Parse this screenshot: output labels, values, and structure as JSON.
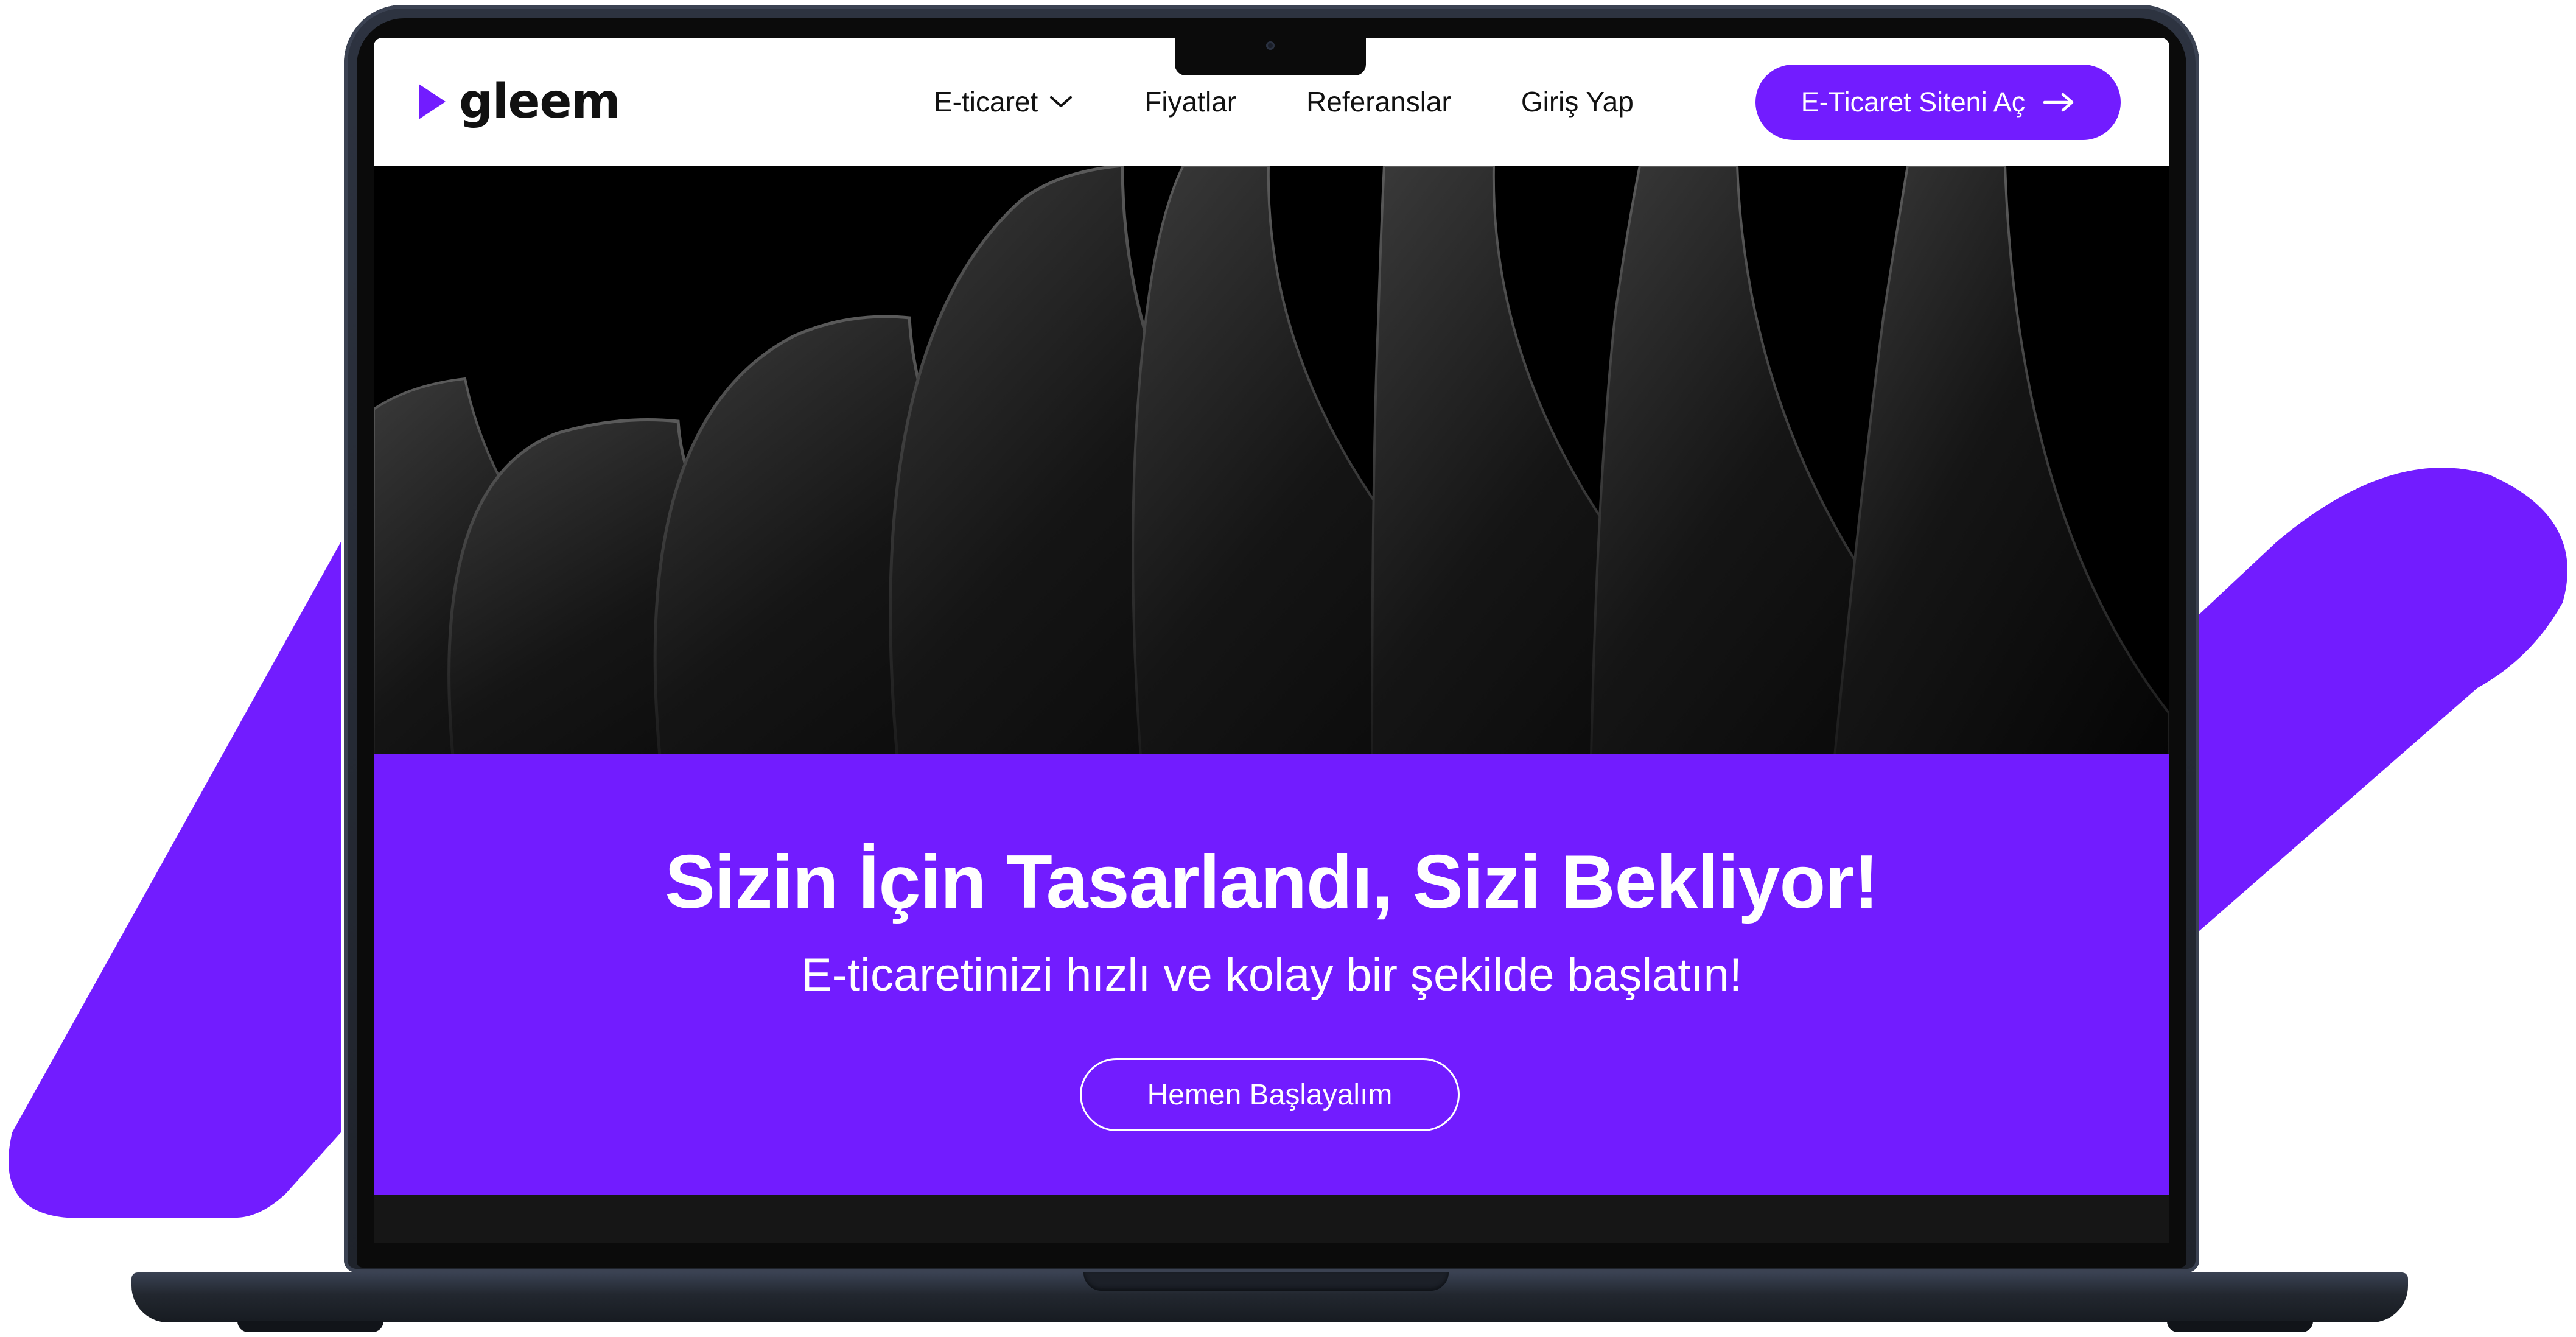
{
  "brand": {
    "name": "gleem",
    "accent_color": "#721cff"
  },
  "nav": {
    "items": [
      {
        "label": "E-ticaret",
        "has_dropdown": true,
        "icon": "chevron-down-icon"
      },
      {
        "label": "Fiyatlar"
      },
      {
        "label": "Referanslar"
      },
      {
        "label": "Giriş Yap"
      }
    ],
    "cta_label": "E-Ticaret Siteni Aç",
    "cta_icon": "arrow-right-icon"
  },
  "hero": {
    "headline": "Sizin İçin Tasarlandı, Sizi Bekliyor!",
    "subline": "E-ticaretinizi hızlı ve kolay bir şekilde başlatın!",
    "button_label": "Hemen Başlayalım"
  }
}
